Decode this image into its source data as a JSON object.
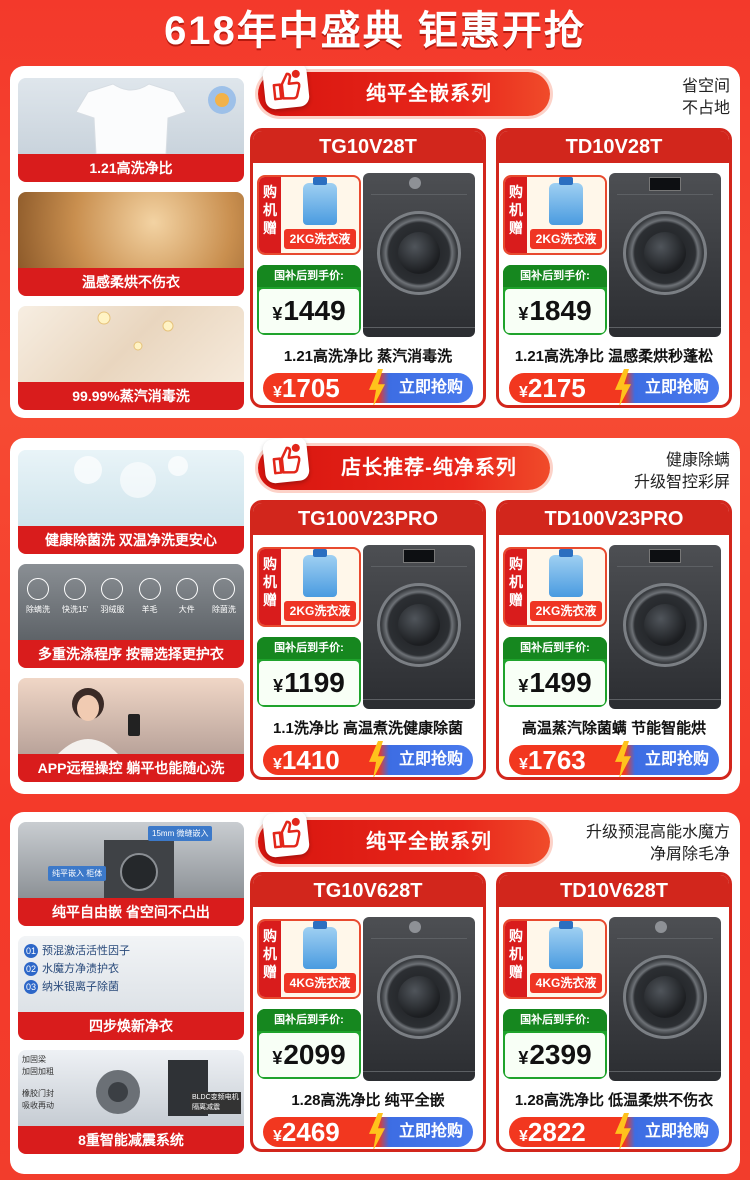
{
  "banner": "618年中盛典 钜惠开抢",
  "colors": {
    "brand_red": "#d2261c",
    "price_green": "#1fa32c",
    "cta_blue": "#4a7bee",
    "bolt_yellow": "#ffc21c"
  },
  "sections": [
    {
      "series_title": "纯平全嵌系列",
      "slogan": [
        "省空间",
        "不占地"
      ],
      "features": [
        "1.21高洗净比",
        "温感柔烘不伤衣",
        "99.99%蒸汽消毒洗"
      ],
      "products": [
        {
          "model": "TG10V28T",
          "gift_side": "购机赠",
          "gift_label": "2KG洗衣液",
          "price_label": "国补后到手价:",
          "yen": "¥",
          "price": "1449",
          "desc": "1.21高洗净比 蒸汽消毒洗",
          "orig_price": "1705",
          "cta": "立即抢购"
        },
        {
          "model": "TD10V28T",
          "gift_side": "购机赠",
          "gift_label": "2KG洗衣液",
          "price_label": "国补后到手价:",
          "yen": "¥",
          "price": "1849",
          "desc": "1.21高洗净比 温感柔烘秒蓬松",
          "orig_price": "2175",
          "cta": "立即抢购"
        }
      ]
    },
    {
      "series_title": "店长推荐-纯净系列",
      "slogan": [
        "健康除螨",
        "升级智控彩屏"
      ],
      "features": [
        "健康除菌洗 双温净洗更安心",
        "多重洗涤程序 按需选择更护衣",
        "APP远程操控 躺平也能随心洗"
      ],
      "program_icons": [
        "除螨洗",
        "快洗15'",
        "羽绒服",
        "羊毛",
        "大件",
        "除菌洗"
      ],
      "products": [
        {
          "model": "TG100V23PRO",
          "gift_side": "购机赠",
          "gift_label": "2KG洗衣液",
          "price_label": "国补后到手价:",
          "yen": "¥",
          "price": "1199",
          "desc": "1.1洗净比 高温煮洗健康除菌",
          "orig_price": "1410",
          "cta": "立即抢购"
        },
        {
          "model": "TD100V23PRO",
          "gift_side": "购机赠",
          "gift_label": "2KG洗衣液",
          "price_label": "国补后到手价:",
          "yen": "¥",
          "price": "1499",
          "desc": "高温蒸汽除菌螨 节能智能烘",
          "orig_price": "1763",
          "cta": "立即抢购"
        }
      ]
    },
    {
      "series_title": "纯平全嵌系列",
      "slogan": [
        "升级预混高能水魔方",
        "净屑除毛净"
      ],
      "features": [
        "纯平自由嵌 省空间不凸出",
        "四步焕新净衣",
        "8重智能减震系统"
      ],
      "cabinet_tags": [
        "15mm 微缝嵌入",
        "纯平嵌入 柜体"
      ],
      "drawer_list": [
        {
          "num": "01",
          "text": "预混激活活性因子"
        },
        {
          "num": "02",
          "text": "水魔方净渍护衣"
        },
        {
          "num": "03",
          "text": "纳米银离子除菌"
        }
      ],
      "motor_tags": [
        "加固梁",
        "加固加粗",
        "橡胶门封",
        "吸收再动",
        "BLDC变频电机",
        "隔离减震"
      ],
      "products": [
        {
          "model": "TG10V628T",
          "gift_side": "购机赠",
          "gift_label": "4KG洗衣液",
          "price_label": "国补后到手价:",
          "yen": "¥",
          "price": "2099",
          "desc": "1.28高洗净比 纯平全嵌",
          "orig_price": "2469",
          "cta": "立即抢购"
        },
        {
          "model": "TD10V628T",
          "gift_side": "购机赠",
          "gift_label": "4KG洗衣液",
          "price_label": "国补后到手价:",
          "yen": "¥",
          "price": "2399",
          "desc": "1.28高洗净比 低温柔烘不伤衣",
          "orig_price": "2822",
          "cta": "立即抢购"
        }
      ]
    }
  ]
}
